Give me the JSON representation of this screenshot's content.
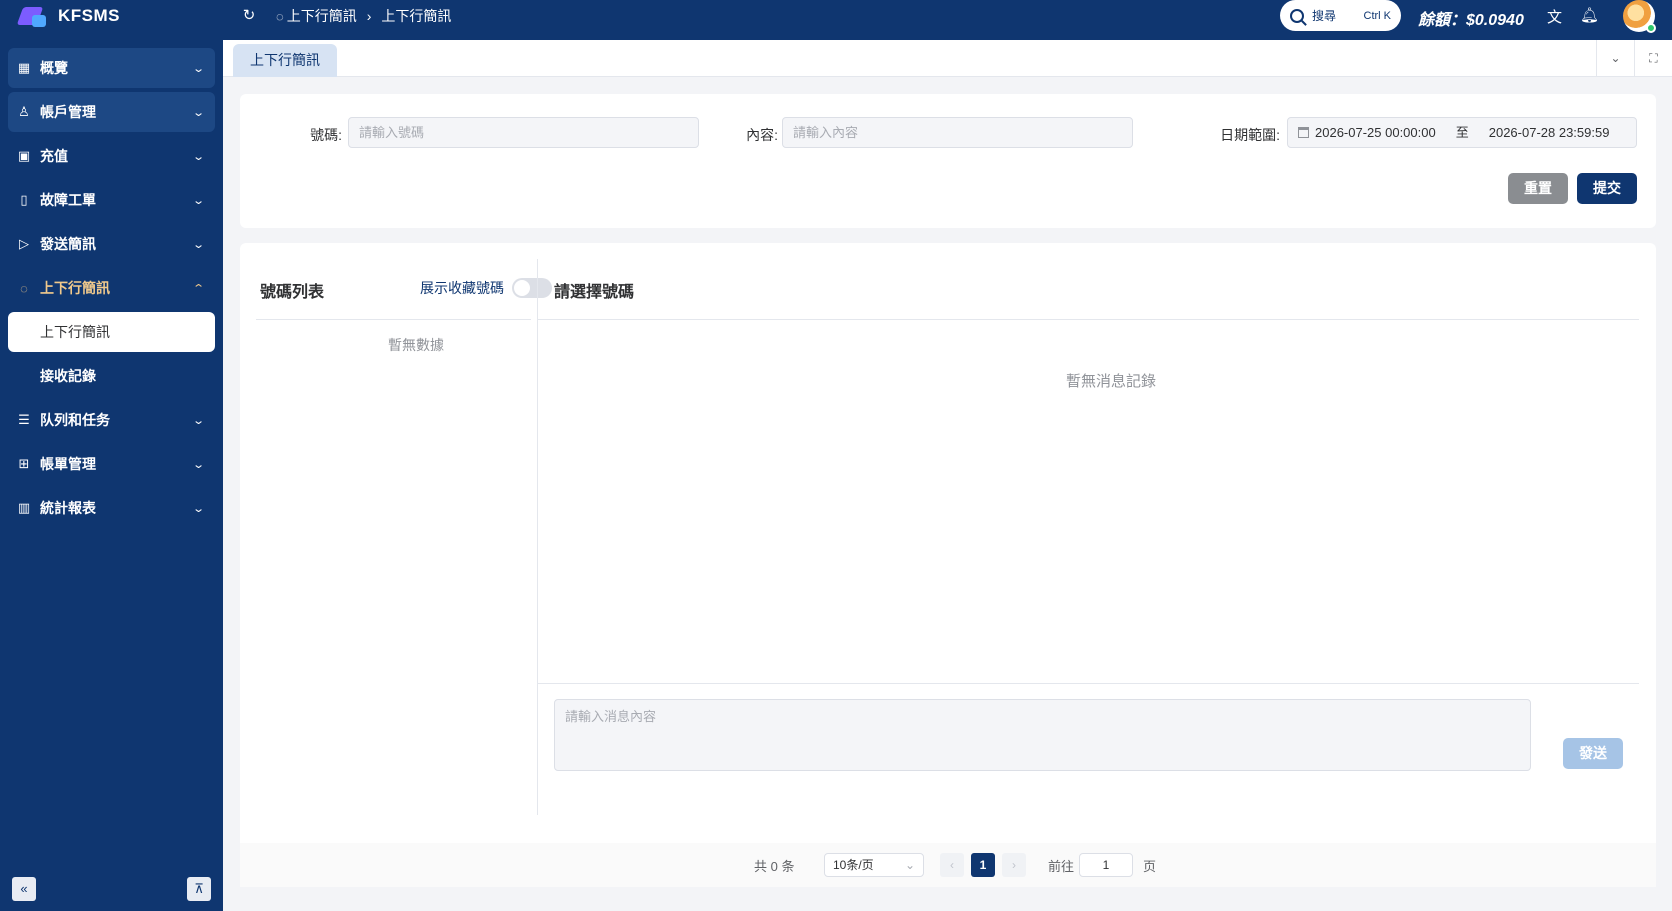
{
  "app": {
    "name": "KFSMS"
  },
  "header": {
    "breadcrumb": [
      "上下行簡訊",
      "上下行簡訊"
    ],
    "breadcrumb_separator": "›",
    "search_label": "搜尋",
    "search_shortcut": "Ctrl K",
    "balance": "餘額：$0.0940",
    "icons": [
      "refresh-icon",
      "translate-icon",
      "bell-icon"
    ]
  },
  "sidebar": {
    "items": [
      {
        "label": "概覽",
        "icon": "dashboard-icon",
        "glyph": "▦",
        "state": "collapsed"
      },
      {
        "label": "帳戶管理",
        "icon": "user-icon",
        "glyph": "♙",
        "state": "collapsed"
      },
      {
        "label": "充值",
        "icon": "wallet-icon",
        "glyph": "▣",
        "state": "collapsed"
      },
      {
        "label": "故障工單",
        "icon": "ticket-icon",
        "glyph": "▯",
        "state": "collapsed"
      },
      {
        "label": "發送簡訊",
        "icon": "send-icon",
        "glyph": "▷",
        "state": "collapsed"
      },
      {
        "label": "上下行簡訊",
        "icon": "chat-icon",
        "glyph": "◌",
        "state": "expanded"
      },
      {
        "label": "队列和任务",
        "icon": "list-icon",
        "glyph": "☰",
        "state": "collapsed"
      },
      {
        "label": "帳單管理",
        "icon": "bill-icon",
        "glyph": "⊞",
        "state": "collapsed"
      },
      {
        "label": "統計報表",
        "icon": "barcode-icon",
        "glyph": "▥",
        "state": "collapsed"
      }
    ],
    "sub_items": [
      {
        "label": "上下行簡訊",
        "active": true
      },
      {
        "label": "接收記錄",
        "active": false
      }
    ],
    "collapse_icon": "«",
    "pin_icon": "⊼"
  },
  "tabs": [
    {
      "label": "上下行簡訊"
    }
  ],
  "filters": {
    "number": {
      "label": "號碼:",
      "placeholder": "請輸入號碼"
    },
    "content": {
      "label": "內容:",
      "placeholder": "請輸入內容"
    },
    "date_range": {
      "label": "日期範圍:",
      "start": "2026-07-25 00:00:00",
      "separator": "至",
      "end": "2026-07-28 23:59:59"
    },
    "reset_label": "重置",
    "submit_label": "提交"
  },
  "number_list": {
    "title": "號碼列表",
    "show_favorites_label": "展示收藏號碼",
    "show_favorites_on": false,
    "empty_text": "暫無數據"
  },
  "conversation": {
    "title": "請選擇號碼",
    "empty_text": "暫無消息記錄",
    "message_placeholder": "請輸入消息內容",
    "send_label": "發送"
  },
  "pagination": {
    "total_text": "共 0 条",
    "page_size": "10条/页",
    "current_page": "1",
    "goto_label": "前往",
    "goto_value": "1",
    "page_suffix": "页"
  },
  "colors": {
    "primary": "#0f3670",
    "active_menu": "#f0c98c",
    "reset_button": "#8a8d91",
    "send_disabled": "#a6c4e6"
  }
}
